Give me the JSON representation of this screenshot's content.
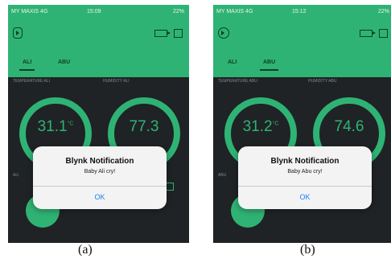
{
  "screens": [
    {
      "status_carrier": "MY MAXIS 4G",
      "status_time": "15:09",
      "status_battery": "22%",
      "tabs": [
        "ALI",
        "ABU"
      ],
      "active_tab": "ALI",
      "temperature_label": "TEMPERATURE ALI",
      "humidity_label": "HUMIDITY ALI",
      "temperature_value": "31.1",
      "temperature_unit": "°C",
      "humidity_value": "77.3",
      "button_label": "ALI",
      "dialog": {
        "title": "Blynk Notification",
        "message": "Baby Ali cry!",
        "ok_label": "OK"
      },
      "caption": "(a)"
    },
    {
      "status_carrier": "MY MAXIS 4G",
      "status_time": "15:12",
      "status_battery": "22%",
      "tabs": [
        "ALI",
        "ABU"
      ],
      "active_tab": "ABU",
      "temperature_label": "TEMPERATURE ABU",
      "humidity_label": "HUMIDITY ABU",
      "temperature_value": "31.2",
      "temperature_unit": "°C",
      "humidity_value": "74.6",
      "button_label": "ABU",
      "dialog": {
        "title": "Blynk Notification",
        "message": "Baby Abu cry!",
        "ok_label": "OK"
      },
      "caption": "(b)"
    }
  ],
  "colors": {
    "accent_green": "#2fb374",
    "app_background": "#1f2325",
    "dialog_background": "#f3f3f3",
    "link_blue": "#1e7cf6"
  },
  "icons": [
    "project-icon",
    "device-icon",
    "settings-square-icon"
  ]
}
